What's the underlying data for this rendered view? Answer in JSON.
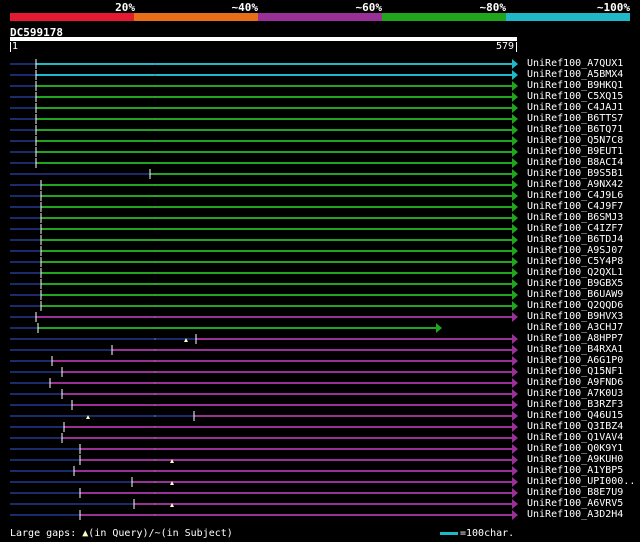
{
  "legend": [
    {
      "label": "20%",
      "color": "#e41a32"
    },
    {
      "label": "~40%",
      "color": "#e86e17"
    },
    {
      "label": "~60%",
      "color": "#983098"
    },
    {
      "label": "~80%",
      "color": "#21a51e"
    },
    {
      "label": "~100%",
      "color": "#1fb8c8"
    }
  ],
  "query": {
    "id": "DC599178",
    "start": "1",
    "end": "579"
  },
  "hits": [
    {
      "id": "UniRef100_A7QUX1",
      "color": "cyan"
    },
    {
      "id": "UniRef100_A5BMX4",
      "color": "cyan"
    },
    {
      "id": "UniRef100_B9HKQ1",
      "color": "green"
    },
    {
      "id": "UniRef100_C5XQ15",
      "color": "green"
    },
    {
      "id": "UniRef100_C4JAJ1",
      "color": "green"
    },
    {
      "id": "UniRef100_B6TTS7",
      "color": "green"
    },
    {
      "id": "UniRef100_B6TQ71",
      "color": "green"
    },
    {
      "id": "UniRef100_Q5N7C8",
      "color": "green"
    },
    {
      "id": "UniRef100_B9EUT1",
      "color": "green"
    },
    {
      "id": "UniRef100_B8ACI4",
      "color": "green"
    },
    {
      "id": "UniRef100_B9S5B1",
      "color": "green"
    },
    {
      "id": "UniRef100_A9NX42",
      "color": "green"
    },
    {
      "id": "UniRef100_C4J9L6",
      "color": "green"
    },
    {
      "id": "UniRef100_C4J9F7",
      "color": "green"
    },
    {
      "id": "UniRef100_B6SMJ3",
      "color": "green"
    },
    {
      "id": "UniRef100_C4IZF7",
      "color": "green"
    },
    {
      "id": "UniRef100_B6TDJ4",
      "color": "green"
    },
    {
      "id": "UniRef100_A9SJ07",
      "color": "green"
    },
    {
      "id": "UniRef100_C5Y4P8",
      "color": "green"
    },
    {
      "id": "UniRef100_Q2QXL1",
      "color": "green"
    },
    {
      "id": "UniRef100_B9GBX5",
      "color": "green"
    },
    {
      "id": "UniRef100_B6UAW9",
      "color": "green"
    },
    {
      "id": "UniRef100_Q2QQD6",
      "color": "green"
    },
    {
      "id": "UniRef100_B9HVX3",
      "color": "purple"
    },
    {
      "id": "UniRef100_A3CHJ7",
      "color": "green"
    },
    {
      "id": "UniRef100_A8HPP7",
      "color": "purple"
    },
    {
      "id": "UniRef100_B4RXA1",
      "color": "purple"
    },
    {
      "id": "UniRef100_A6G1P0",
      "color": "purple"
    },
    {
      "id": "UniRef100_Q15NF1",
      "color": "purple"
    },
    {
      "id": "UniRef100_A9FND6",
      "color": "purple"
    },
    {
      "id": "UniRef100_A7K0U3",
      "color": "purple"
    },
    {
      "id": "UniRef100_B3RZF3",
      "color": "purple"
    },
    {
      "id": "UniRef100_Q46U15",
      "color": "purple"
    },
    {
      "id": "UniRef100_Q3IBZ4",
      "color": "purple"
    },
    {
      "id": "UniRef100_Q1VAV4",
      "color": "purple"
    },
    {
      "id": "UniRef100_Q0K9Y1",
      "color": "purple"
    },
    {
      "id": "UniRef100_A9KUH0",
      "color": "purple"
    },
    {
      "id": "UniRef100_A1YBP5",
      "color": "purple"
    },
    {
      "id": "UniRef100_UPI000..",
      "color": "purple"
    },
    {
      "id": "UniRef100_B8E7U9",
      "color": "purple"
    },
    {
      "id": "UniRef100_A6VRV5",
      "color": "purple"
    },
    {
      "id": "UniRef100_A3D2H4",
      "color": "purple"
    }
  ],
  "colors": {
    "cyan": "#1fb8c8",
    "green": "#21a51e",
    "purple": "#983098",
    "subject": "#1a2a6a",
    "gap": "#ffffc0"
  },
  "footer": {
    "large_gaps": "Large gaps:",
    "query_marker": "▲",
    "in_query": "(in Query)/",
    "subject_marker": "~",
    "in_subject": "(in Subject)",
    "scale_text": "=100char."
  }
}
